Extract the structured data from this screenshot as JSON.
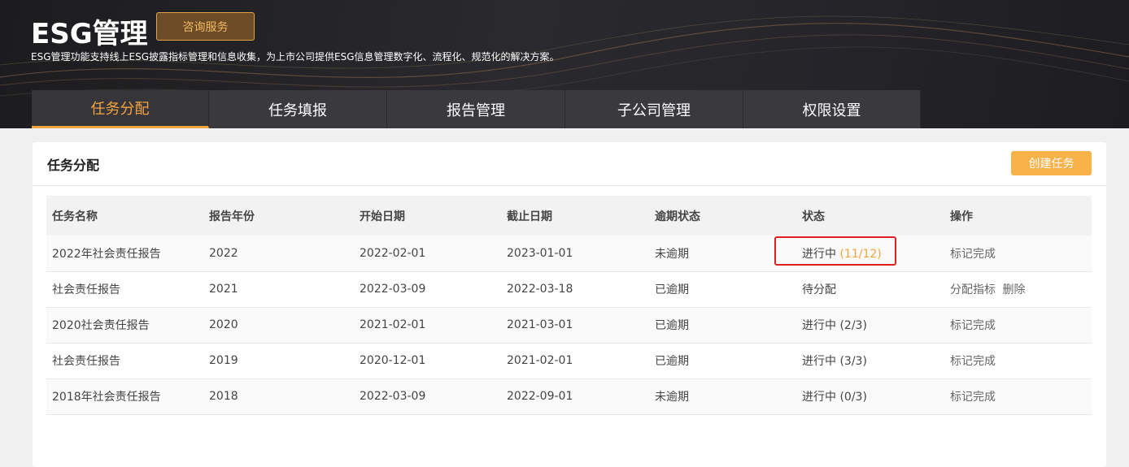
{
  "hero": {
    "title": "ESG管理",
    "consult_label": "咨询服务",
    "subtitle": "ESG管理功能支持线上ESG披露指标管理和信息收集，为上市公司提供ESG信息管理数字化、流程化、规范化的解决方案。"
  },
  "tabs": [
    {
      "label": "任务分配",
      "active": true
    },
    {
      "label": "任务填报",
      "active": false
    },
    {
      "label": "报告管理",
      "active": false
    },
    {
      "label": "子公司管理",
      "active": false
    },
    {
      "label": "权限设置",
      "active": false
    }
  ],
  "card": {
    "title": "任务分配",
    "create_label": "创建任务"
  },
  "table": {
    "headers": [
      "任务名称",
      "报告年份",
      "开始日期",
      "截止日期",
      "逾期状态",
      "状态",
      "操作"
    ],
    "rows": [
      {
        "name": "2022年社会责任报告",
        "year": "2022",
        "start": "2022-02-01",
        "end": "2023-01-01",
        "overdue": "未逾期",
        "status": "进行中",
        "progress": "(11/12)",
        "actions": [
          "标记完成"
        ]
      },
      {
        "name": "社会责任报告",
        "year": "2021",
        "start": "2022-03-09",
        "end": "2022-03-18",
        "overdue": "已逾期",
        "status": "待分配",
        "progress": "",
        "actions": [
          "分配指标",
          "删除"
        ]
      },
      {
        "name": "2020社会责任报告",
        "year": "2020",
        "start": "2021-02-01",
        "end": "2021-03-01",
        "overdue": "已逾期",
        "status": "进行中",
        "progress": "(2/3)",
        "actions": [
          "标记完成"
        ]
      },
      {
        "name": "社会责任报告",
        "year": "2019",
        "start": "2020-12-01",
        "end": "2021-02-01",
        "overdue": "已逾期",
        "status": "进行中",
        "progress": "(3/3)",
        "actions": [
          "标记完成"
        ]
      },
      {
        "name": "2018年社会责任报告",
        "year": "2018",
        "start": "2022-03-09",
        "end": "2022-09-01",
        "overdue": "未逾期",
        "status": "进行中",
        "progress": "(0/3)",
        "actions": [
          "标记完成"
        ]
      }
    ]
  },
  "colors": {
    "accent": "#f5a43d",
    "highlight": "#e02020",
    "button": "#f8b24a"
  }
}
